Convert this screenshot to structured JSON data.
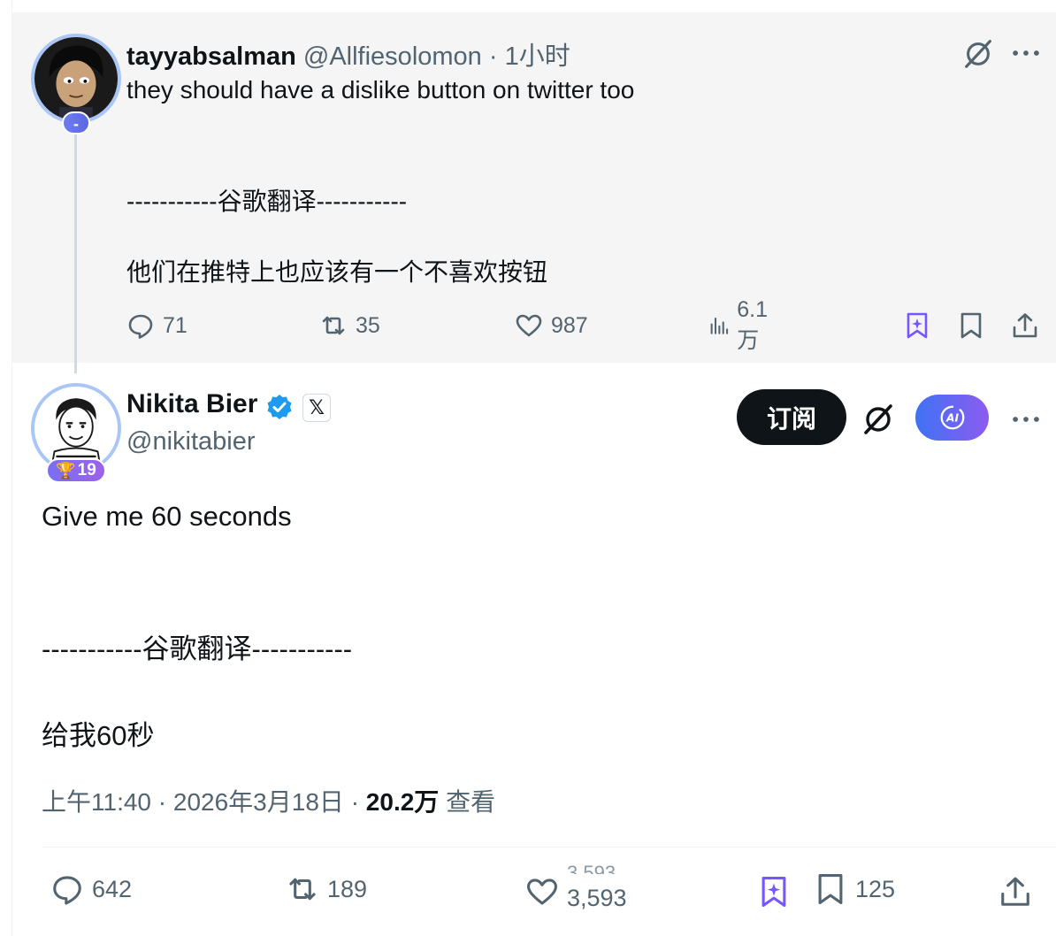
{
  "parent_tweet": {
    "display_name": "tayyabsalman",
    "handle": "@Allfiesolomon",
    "separator": " · ",
    "time": "1小时",
    "level": "-",
    "text": "they should have a dislike button on twitter too",
    "translation_divider": "-----------谷歌翻译-----------",
    "translation": "他们在推特上也应该有一个不喜欢按钮",
    "stats": {
      "replies": "71",
      "reposts": "35",
      "likes": "987",
      "views": "6.1万"
    }
  },
  "main_tweet": {
    "display_name": "Nikita Bier",
    "handle": "@nikitabier",
    "affiliate_badge": "𝕏",
    "level": "19",
    "level_icon": "trophy-icon",
    "subscribe_label": "订阅",
    "ai_label": "AI",
    "text": "Give me 60 seconds",
    "translation_divider": "-----------谷歌翻译-----------",
    "translation": "给我60秒",
    "time": "上午11:40",
    "date": "2026年3月18日",
    "views_count": "20.2万",
    "views_label": "查看",
    "stats": {
      "replies": "642",
      "reposts": "189",
      "likes_previous": "3,593",
      "likes": "3,593",
      "bookmarks": "125"
    }
  },
  "colors": {
    "accent_purple": "#7856ff",
    "verified_blue": "#1d9bf0",
    "text_secondary": "#536471",
    "parent_bg": "#f5f5f5"
  }
}
